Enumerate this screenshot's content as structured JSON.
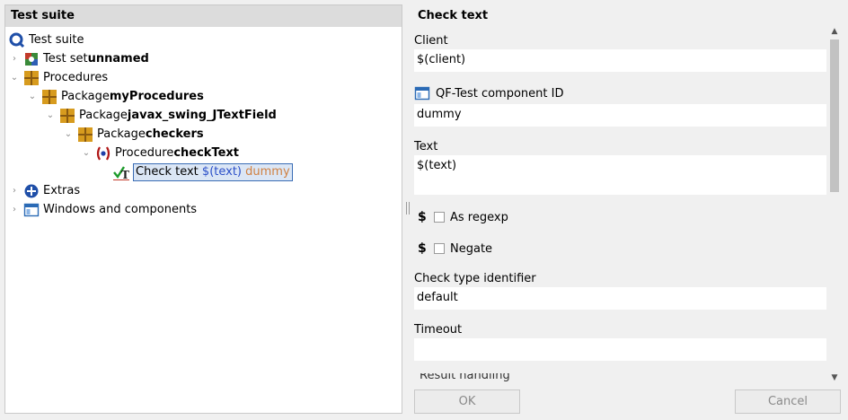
{
  "tree": {
    "header": "Test suite",
    "items": [
      {
        "label": "Test suite",
        "bold": ""
      },
      {
        "label": "Test set ",
        "bold": "unnamed"
      },
      {
        "label": "Procedures",
        "bold": ""
      },
      {
        "label": "Package ",
        "bold": "myProcedures"
      },
      {
        "label": "Package ",
        "bold": "javax_swing_JTextField"
      },
      {
        "label": "Package ",
        "bold": "checkers"
      },
      {
        "label": "Procedure ",
        "bold": "checkText"
      },
      {
        "label": "Check text ",
        "var": "$(text)",
        "extra": "dummy"
      },
      {
        "label": "Extras",
        "bold": ""
      },
      {
        "label": "Windows and components",
        "bold": ""
      }
    ]
  },
  "detail": {
    "title": "Check text",
    "client_label": "Client",
    "client_value": "$(client)",
    "component_label": "QF-Test component ID",
    "component_value": "dummy",
    "text_label": "Text",
    "text_value": "$(text)",
    "dollar_symbol": "$",
    "as_regexp_label": "As regexp",
    "negate_label": "Negate",
    "check_type_label": "Check type identifier",
    "check_type_value": "default",
    "timeout_label": "Timeout",
    "timeout_value": "",
    "result_handling_label": "Result handling"
  },
  "buttons": {
    "ok": "OK",
    "cancel": "Cancel"
  },
  "colors": {
    "variable": "#2b4fc8",
    "extra": "#d08040",
    "selection_border": "#3b6db5",
    "header_bg": "#dcdcdc"
  },
  "icons": [
    "qf-test-icon",
    "test-set-icon",
    "package-icon",
    "procedure-icon",
    "check-icon",
    "extras-icon",
    "window-icon",
    "chevron-right-icon",
    "chevron-down-icon"
  ]
}
